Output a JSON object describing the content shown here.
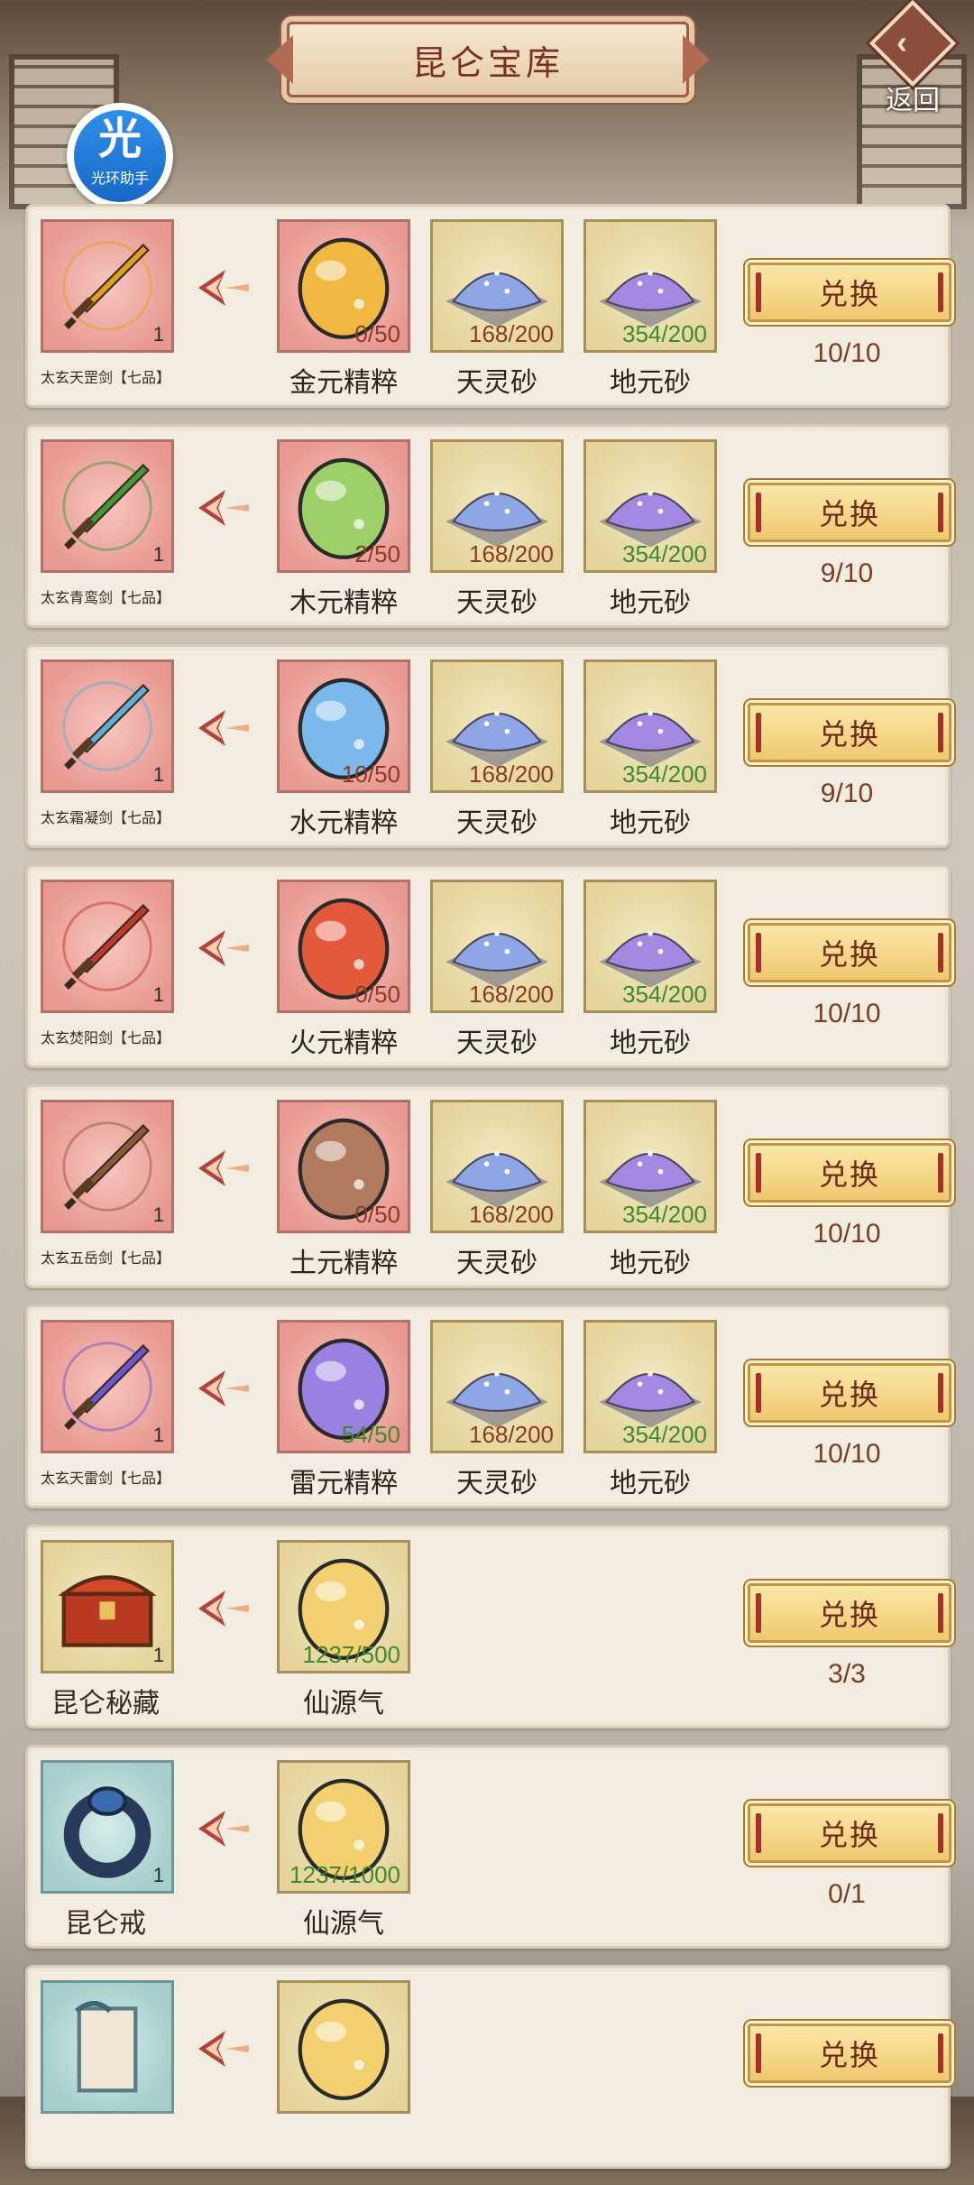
{
  "header": {
    "title": "昆仑宝库",
    "back_label": "返回"
  },
  "badge": {
    "char": "光",
    "name": "光环助手"
  },
  "exchange_label": "兑换",
  "rows": [
    {
      "reward": {
        "name": "太玄天罡剑【七品】",
        "count": "1",
        "style": "pink",
        "icon": "golden-sword-icon",
        "color": "#e0a020"
      },
      "costs": [
        {
          "name": "金元精粹",
          "qty": "0/50",
          "ok": false,
          "style": "pink",
          "icon": "gold-essence-orb-icon",
          "color": "#f0b840"
        },
        {
          "name": "天灵砂",
          "qty": "168/200",
          "ok": false,
          "style": "gold",
          "icon": "blue-sand-icon",
          "color": "#8ea6e6"
        },
        {
          "name": "地元砂",
          "qty": "354/200",
          "ok": true,
          "style": "gold",
          "icon": "purple-sand-icon",
          "color": "#a488e2"
        }
      ],
      "limit": "10/10"
    },
    {
      "reward": {
        "name": "太玄青鸾剑【七品】",
        "count": "1",
        "style": "pink",
        "icon": "green-sword-icon",
        "color": "#3f9a3a"
      },
      "costs": [
        {
          "name": "木元精粹",
          "qty": "2/50",
          "ok": false,
          "style": "pink",
          "icon": "wood-essence-orb-icon",
          "color": "#9ed06a"
        },
        {
          "name": "天灵砂",
          "qty": "168/200",
          "ok": false,
          "style": "gold",
          "icon": "blue-sand-icon",
          "color": "#8ea6e6"
        },
        {
          "name": "地元砂",
          "qty": "354/200",
          "ok": true,
          "style": "gold",
          "icon": "purple-sand-icon",
          "color": "#a488e2"
        }
      ],
      "limit": "9/10"
    },
    {
      "reward": {
        "name": "太玄霜凝剑【七品】",
        "count": "1",
        "style": "pink",
        "icon": "ice-sword-icon",
        "color": "#5ab0d8"
      },
      "costs": [
        {
          "name": "水元精粹",
          "qty": "10/50",
          "ok": false,
          "style": "pink",
          "icon": "water-essence-orb-icon",
          "color": "#7ab8ec"
        },
        {
          "name": "天灵砂",
          "qty": "168/200",
          "ok": false,
          "style": "gold",
          "icon": "blue-sand-icon",
          "color": "#8ea6e6"
        },
        {
          "name": "地元砂",
          "qty": "354/200",
          "ok": true,
          "style": "gold",
          "icon": "purple-sand-icon",
          "color": "#a488e2"
        }
      ],
      "limit": "9/10"
    },
    {
      "reward": {
        "name": "太玄焚阳剑【七品】",
        "count": "1",
        "style": "pink",
        "icon": "fire-sword-icon",
        "color": "#c0382a"
      },
      "costs": [
        {
          "name": "火元精粹",
          "qty": "0/50",
          "ok": false,
          "style": "pink",
          "icon": "fire-essence-orb-icon",
          "color": "#e25a3a"
        },
        {
          "name": "天灵砂",
          "qty": "168/200",
          "ok": false,
          "style": "gold",
          "icon": "blue-sand-icon",
          "color": "#8ea6e6"
        },
        {
          "name": "地元砂",
          "qty": "354/200",
          "ok": true,
          "style": "gold",
          "icon": "purple-sand-icon",
          "color": "#a488e2"
        }
      ],
      "limit": "10/10"
    },
    {
      "reward": {
        "name": "太玄五岳剑【七品】",
        "count": "1",
        "style": "pink",
        "icon": "earth-sword-icon",
        "color": "#8a5a3a"
      },
      "costs": [
        {
          "name": "土元精粹",
          "qty": "0/50",
          "ok": false,
          "style": "pink",
          "icon": "earth-essence-orb-icon",
          "color": "#b07a5e"
        },
        {
          "name": "天灵砂",
          "qty": "168/200",
          "ok": false,
          "style": "gold",
          "icon": "blue-sand-icon",
          "color": "#8ea6e6"
        },
        {
          "name": "地元砂",
          "qty": "354/200",
          "ok": true,
          "style": "gold",
          "icon": "purple-sand-icon",
          "color": "#a488e2"
        }
      ],
      "limit": "10/10"
    },
    {
      "reward": {
        "name": "太玄天雷剑【七品】",
        "count": "1",
        "style": "pink",
        "icon": "thunder-sword-icon",
        "color": "#6a58d0"
      },
      "costs": [
        {
          "name": "雷元精粹",
          "qty": "54/50",
          "ok": true,
          "style": "pink",
          "icon": "thunder-essence-orb-icon",
          "color": "#9a80e0"
        },
        {
          "name": "天灵砂",
          "qty": "168/200",
          "ok": false,
          "style": "gold",
          "icon": "blue-sand-icon",
          "color": "#8ea6e6"
        },
        {
          "name": "地元砂",
          "qty": "354/200",
          "ok": true,
          "style": "gold",
          "icon": "purple-sand-icon",
          "color": "#a488e2"
        }
      ],
      "limit": "10/10"
    },
    {
      "reward": {
        "name": "昆仑秘藏",
        "count": "1",
        "style": "gold",
        "icon": "treasure-chest-icon",
        "color": "#b83a22",
        "big": true
      },
      "costs": [
        {
          "name": "仙源气",
          "qty": "1237/500",
          "ok": true,
          "style": "gold",
          "icon": "immortal-qi-orb-icon",
          "color": "#f2d070"
        }
      ],
      "limit": "3/3"
    },
    {
      "reward": {
        "name": "昆仑戒",
        "count": "1",
        "style": "teal",
        "icon": "ring-icon",
        "color": "#2a3a5a",
        "big": true
      },
      "costs": [
        {
          "name": "仙源气",
          "qty": "1237/1000",
          "ok": true,
          "style": "gold",
          "icon": "immortal-qi-orb-icon",
          "color": "#f2d070"
        }
      ],
      "limit": "0/1"
    },
    {
      "reward": {
        "name": "",
        "count": "",
        "style": "teal",
        "icon": "scroll-icon",
        "color": "#c8c0b0",
        "big": true
      },
      "costs": [
        {
          "name": "",
          "qty": "",
          "ok": true,
          "style": "gold",
          "icon": "immortal-qi-orb-icon",
          "color": "#f2d070"
        }
      ],
      "limit": ""
    }
  ]
}
